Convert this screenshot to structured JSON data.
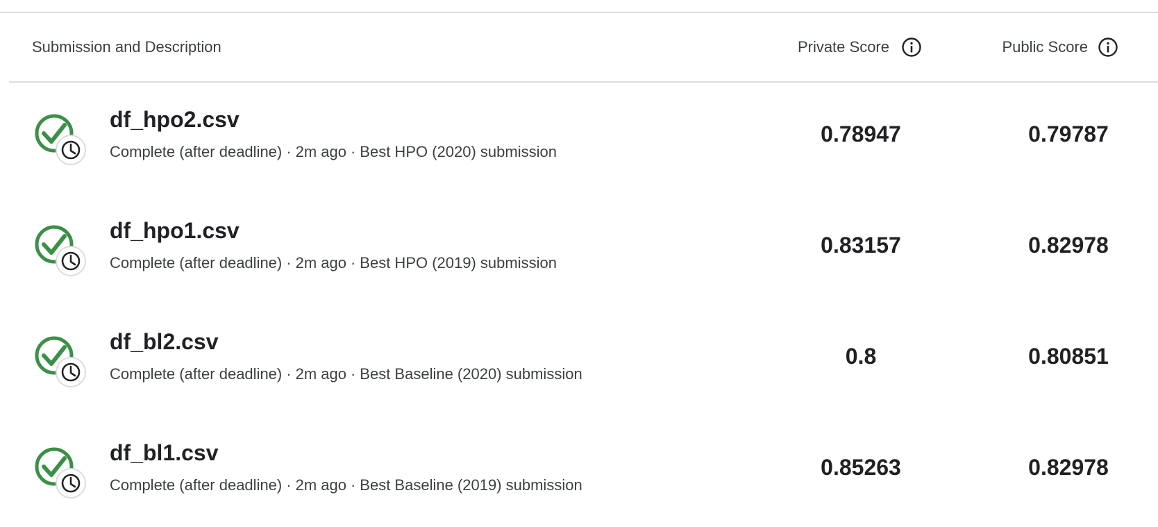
{
  "header": {
    "submission_label": "Submission and Description",
    "private_label": "Private Score",
    "public_label": "Public Score"
  },
  "colors": {
    "success": "#3c8f48",
    "divider": "#dadce0",
    "text": "#202124",
    "muted": "#3c4043"
  },
  "icons": {
    "status": "check-circle-with-clock-icon",
    "info": "info-circle-icon"
  },
  "submissions": [
    {
      "file": "df_hpo2.csv",
      "status": "Complete (after deadline)",
      "time": "2m ago",
      "description": "Best HPO (2020) submission",
      "private_score": "0.78947",
      "public_score": "0.79787"
    },
    {
      "file": "df_hpo1.csv",
      "status": "Complete (after deadline)",
      "time": "2m ago",
      "description": "Best HPO (2019) submission",
      "private_score": "0.83157",
      "public_score": "0.82978"
    },
    {
      "file": "df_bl2.csv",
      "status": "Complete (after deadline)",
      "time": "2m ago",
      "description": "Best Baseline (2020) submission",
      "private_score": "0.8",
      "public_score": "0.80851"
    },
    {
      "file": "df_bl1.csv",
      "status": "Complete (after deadline)",
      "time": "2m ago",
      "description": "Best Baseline (2019) submission",
      "private_score": "0.85263",
      "public_score": "0.82978"
    }
  ]
}
